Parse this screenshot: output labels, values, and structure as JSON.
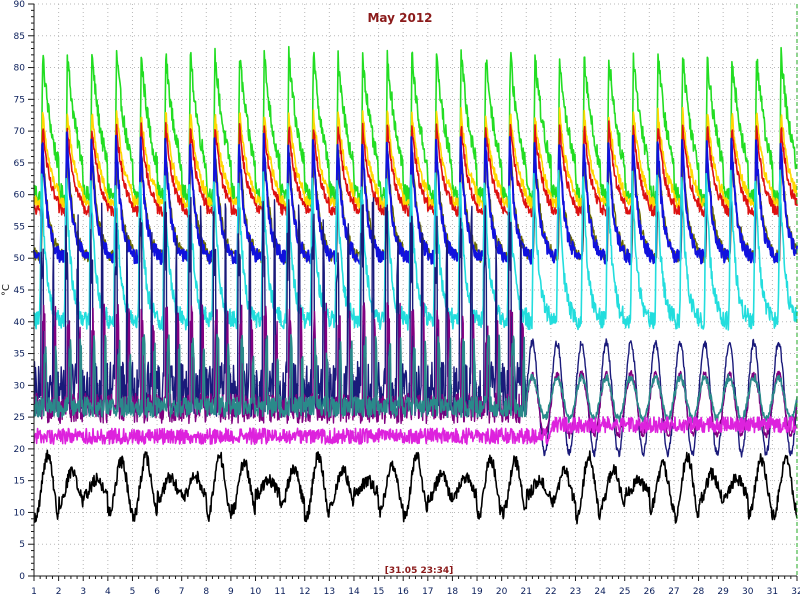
{
  "chart_data": {
    "type": "line",
    "title": "May 2012",
    "xlabel": "",
    "ylabel": "°C",
    "xlim": [
      1,
      32
    ],
    "ylim": [
      0,
      90
    ],
    "x_ticks": [
      "1",
      "2",
      "3",
      "4",
      "5",
      "6",
      "7",
      "8",
      "9",
      "10",
      "11",
      "12",
      "13",
      "14",
      "15",
      "16",
      "17",
      "18",
      "19",
      "20",
      "21",
      "22",
      "23",
      "24",
      "25",
      "26",
      "27",
      "28",
      "29",
      "30",
      "31",
      "32"
    ],
    "y_ticks": [
      "0",
      "5",
      "10",
      "15",
      "20",
      "25",
      "30",
      "35",
      "40",
      "45",
      "50",
      "55",
      "60",
      "65",
      "70",
      "75",
      "80",
      "85",
      "90"
    ],
    "grid": true,
    "timestamp": "[31.05 23:34]",
    "series": [
      {
        "color": "#22dd22",
        "pattern": "daily_peaks",
        "base": 57,
        "peak": 82,
        "phase": 0.35,
        "decay": 0.55,
        "width": 1.6
      },
      {
        "color": "#ffd700",
        "pattern": "daily_peaks",
        "base": 58,
        "peak": 73,
        "phase": 0.35,
        "decay": 0.35,
        "width": 1.6
      },
      {
        "color": "#dd1111",
        "pattern": "daily_peaks",
        "base": 57,
        "peak": 71,
        "phase": 0.35,
        "decay": 0.3,
        "width": 1.6
      },
      {
        "color": "#6b6b00",
        "pattern": "daily_peaks",
        "base": 50,
        "peak": 67,
        "phase": 0.36,
        "decay": 0.25,
        "width": 1.4
      },
      {
        "color": "#1111dd",
        "pattern": "daily_peaks",
        "base": 50,
        "peak": 69,
        "phase": 0.33,
        "decay": 0.22,
        "width": 2
      },
      {
        "color": "#22dddd",
        "pattern": "daily_peaks",
        "base": 40,
        "peak": 64,
        "phase": 0.3,
        "decay": 0.2,
        "width": 1.6
      },
      {
        "color": "#1a1a7a",
        "pattern": "spiky_low",
        "base": 25,
        "peak": 60,
        "phase": 0.33,
        "decay": 0.12,
        "width": 1.4
      },
      {
        "color": "#800080",
        "pattern": "spiky_low",
        "base": 24,
        "peak": 43,
        "phase": 0.4,
        "decay": 0.15,
        "width": 1.4
      },
      {
        "color": "#2a8a8a",
        "pattern": "spiky_low",
        "base": 25,
        "peak": 38,
        "phase": 0.45,
        "decay": 0.15,
        "width": 1.6
      },
      {
        "color": "#dd22dd",
        "pattern": "flat_noise",
        "base": 22,
        "peak": 24.5,
        "phase": 0,
        "decay": 0,
        "width": 1.6
      },
      {
        "color": "#000000",
        "pattern": "ambient",
        "base": 12,
        "peak": 22,
        "phase": 0.55,
        "decay": 0,
        "width": 1.6
      }
    ]
  }
}
